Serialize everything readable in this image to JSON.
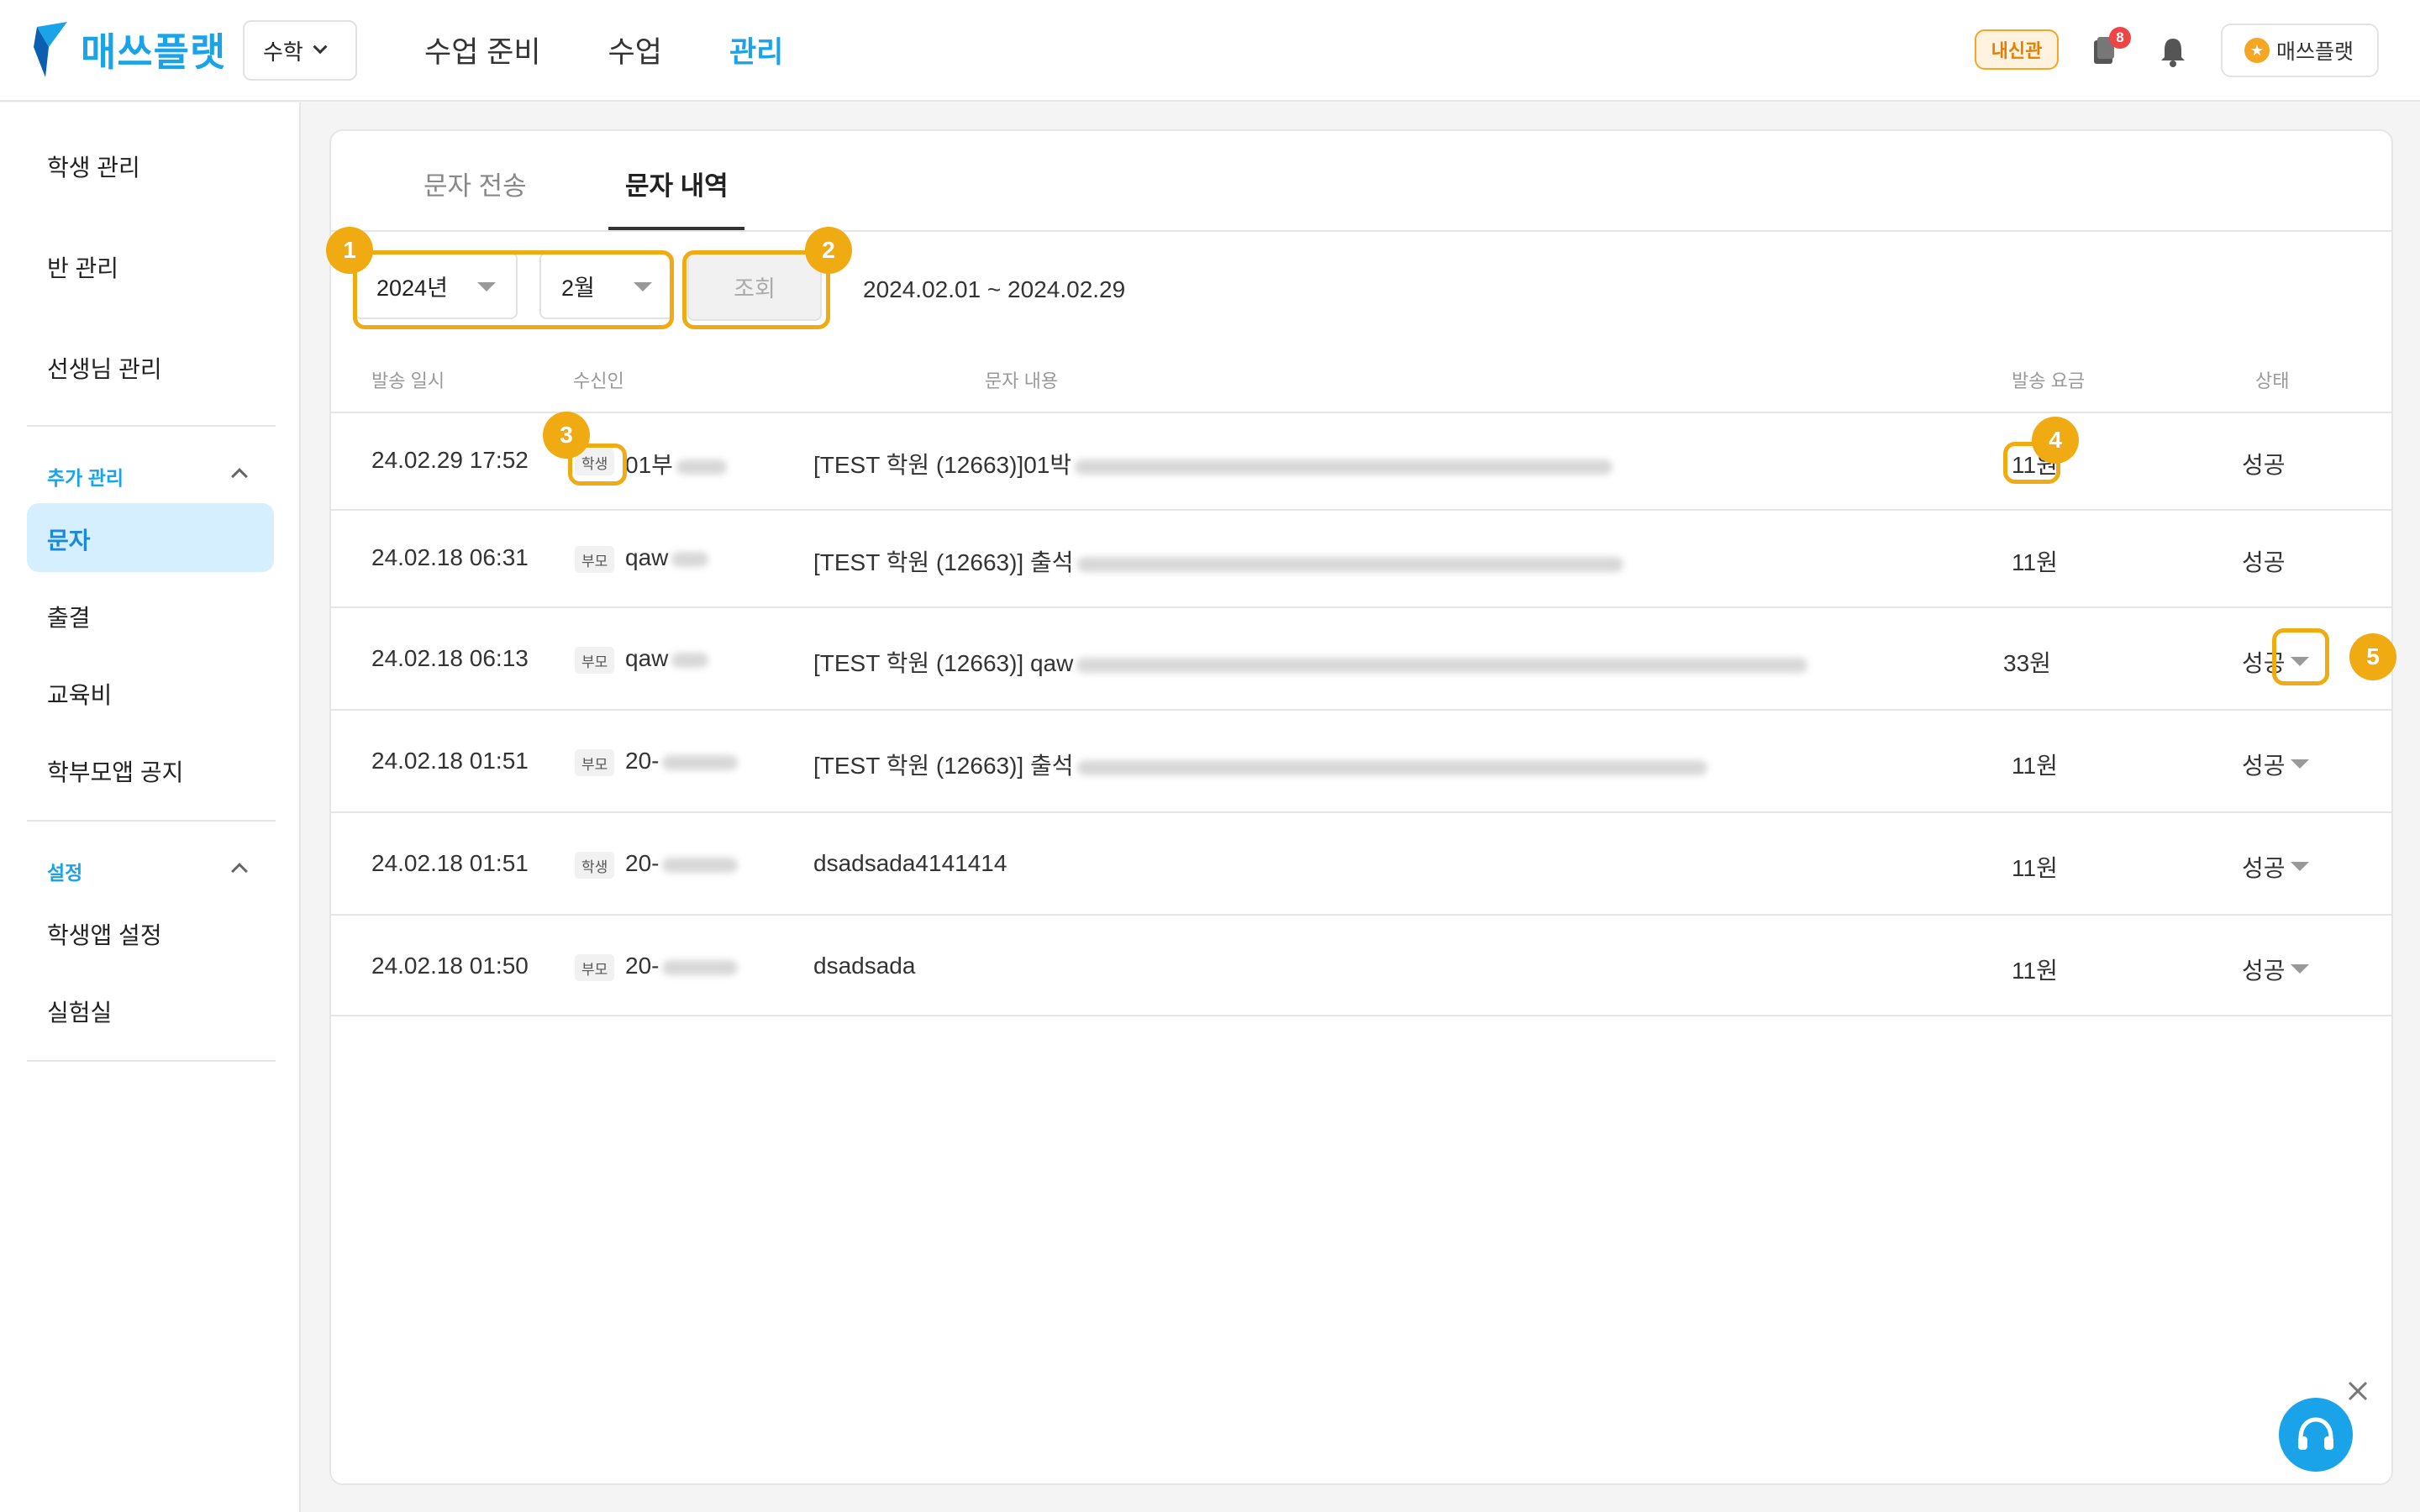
{
  "header": {
    "brand": "매쓰플랫",
    "subject": "수학",
    "nav": [
      {
        "label": "수업 준비",
        "active": false
      },
      {
        "label": "수업",
        "active": false
      },
      {
        "label": "관리",
        "active": true
      }
    ],
    "branch_badge": "내신관",
    "notification_count": "8",
    "profile_label": "매쓰플랫"
  },
  "sidebar": {
    "items_top": [
      "학생 관리",
      "반 관리",
      "선생님 관리"
    ],
    "section_extra": "추가 관리",
    "items_extra": [
      "문자",
      "출결",
      "교육비",
      "학부모앱 공지"
    ],
    "active_item": "문자",
    "section_settings": "설정",
    "items_settings": [
      "학생앱 설정",
      "실험실"
    ]
  },
  "tabs": {
    "send": "문자 전송",
    "history": "문자 내역"
  },
  "filter": {
    "year": "2024년",
    "month": "2월",
    "query_button": "조회",
    "date_range": "2024.02.01 ~ 2024.02.29"
  },
  "table": {
    "headers": {
      "sent_at": "발송 일시",
      "recipient": "수신인",
      "content": "문자 내용",
      "fee": "발송 요금",
      "status": "상태"
    },
    "rows": [
      {
        "sent_at": "24.02.29 17:52",
        "recipient_type": "학생",
        "recipient": "01부",
        "content": "[TEST 학원 (12663)]01박",
        "fee": "11원",
        "status": "성공"
      },
      {
        "sent_at": "24.02.18 06:31",
        "recipient_type": "부모",
        "recipient": "qaw",
        "content": "[TEST 학원 (12663)] 출석",
        "fee": "11원",
        "status": "성공"
      },
      {
        "sent_at": "24.02.18 06:13",
        "recipient_type": "부모",
        "recipient": "qaw",
        "content": "[TEST 학원 (12663)] qaw",
        "fee": "33원",
        "status": "성공"
      },
      {
        "sent_at": "24.02.18 01:51",
        "recipient_type": "부모",
        "recipient": "20-",
        "content": "[TEST 학원 (12663)] 출석",
        "fee": "11원",
        "status": "성공"
      },
      {
        "sent_at": "24.02.18 01:51",
        "recipient_type": "학생",
        "recipient": "20-",
        "content": "dsadsada4141414",
        "fee": "11원",
        "status": "성공"
      },
      {
        "sent_at": "24.02.18 01:50",
        "recipient_type": "부모",
        "recipient": "20-",
        "content": "dsadsada",
        "fee": "11원",
        "status": "성공"
      }
    ]
  },
  "markers": [
    "1",
    "2",
    "3",
    "4",
    "5"
  ],
  "colors": {
    "brand": "#1aa3e8",
    "highlight": "#f0ab12",
    "active_bg": "#d6efff"
  }
}
